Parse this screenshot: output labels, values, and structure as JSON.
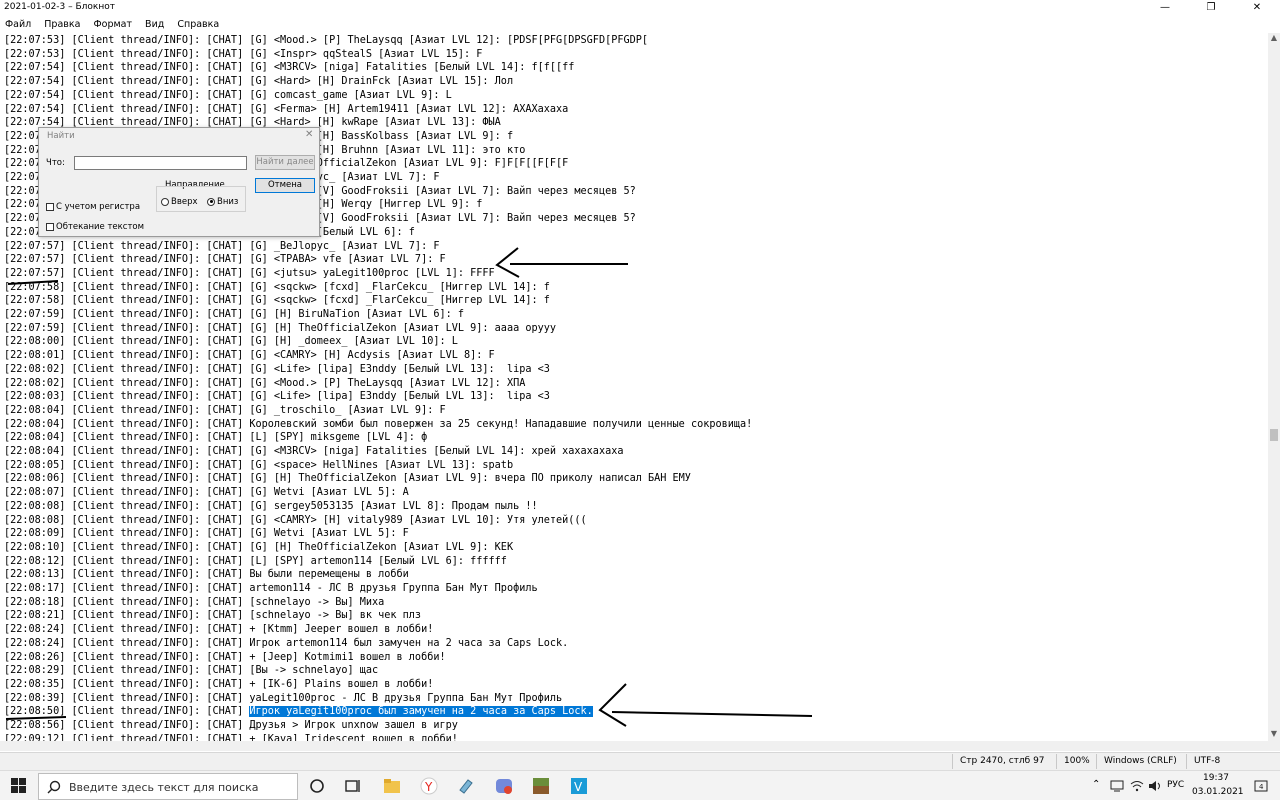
{
  "window": {
    "title": "2021-01-02-3 – Блокнот"
  },
  "menu": [
    "Файл",
    "Правка",
    "Формат",
    "Вид",
    "Справка"
  ],
  "lines": [
    "[22:07:53] [Client thread/INFO]: [CHAT] [G] <Mood.> [P] TheLaysqq [Азиат LVL 12]: [PDSF[PFG[DPSGFD[PFGDP[",
    "[22:07:53] [Client thread/INFO]: [CHAT] [G] <Inspr> qqStealS [Азиат LVL 15]: F",
    "[22:07:54] [Client thread/INFO]: [CHAT] [G] <M3RCV> [niga] Fatalities [Белый LVL 14]: f[f[[ff",
    "[22:07:54] [Client thread/INFO]: [CHAT] [G] <Hard> [H] DrainFck [Азиат LVL 15]: Лол",
    "[22:07:54] [Client thread/INFO]: [CHAT] [G] comcast_game [Азиат LVL 9]: L",
    "[22:07:54] [Client thread/INFO]: [CHAT] [G] <Ferma> [H] Artem19411 [Азиат LVL 12]: АХАХахаха",
    "[22:07:54] [Client thread/INFO]: [CHAT] [G] <Hard> [H] kwRape [Азиат LVL 13]: ФЫА",
    "[22:07:54] [Client thread/INFO]: [CHAT] [G] <Hard> [H] BassKolbass [Азиат LVL 9]: f",
    "[22:07:55] [Client thread/INFO]: [CHAT] [G] <Hard> [H] Bruhnn [Азиат LVL 11]: это кто",
    "[22:07:55] [Client thread/INFO]: [CHAT] [G] [H] TheOfficialZekon [Азиат LVL 9]: F]F[F[[F[F[F",
    "[22:07:55] [Client thread/INFO]: [CHAT] [G] _BeJlopyc_ [Азиат LVL 7]: F",
    "[22:07:56] [Client thread/INFO]: [CHAT] [G] <Hard> [V] GoodFroksii [Азиат LVL 7]: Вайп через месяцев 5?",
    "[22:07:56] [Client thread/INFO]: [CHAT] [G] <Hard> [H] Werqy [Ниггер LVL 9]: f",
    "[22:07:56] [Client thread/INFO]: [CHAT] [G] <Hard> [V] GoodFroksii [Азиат LVL 7]: Вайп через месяцев 5?",
    "[22:07:57] [Client thread/INFO]: [CHAT] [G] ramyo4 [Белый LVL 6]: f",
    "[22:07:57] [Client thread/INFO]: [CHAT] [G] _BeJlopyc_ [Азиат LVL 7]: F",
    "[22:07:57] [Client thread/INFO]: [CHAT] [G] <TPABA> vfe [Азиат LVL 7]: F",
    "[22:07:57] [Client thread/INFO]: [CHAT] [G] <jutsu> yaLegit100proc [LVL 1]: FFFF",
    "[22:07:58] [Client thread/INFO]: [CHAT] [G] <sqckw> [fcxd] _FlarCekcu_ [Ниггер LVL 14]: f",
    "[22:07:58] [Client thread/INFO]: [CHAT] [G] <sqckw> [fcxd] _FlarCekcu_ [Ниггер LVL 14]: f",
    "[22:07:59] [Client thread/INFO]: [CHAT] [G] [H] BiruNaTion [Азиат LVL 6]: f",
    "[22:07:59] [Client thread/INFO]: [CHAT] [G] [H] TheOfficialZekon [Азиат LVL 9]: аааа оруyy",
    "[22:08:00] [Client thread/INFO]: [CHAT] [G] [H] _domeex_ [Азиат LVL 10]: L",
    "[22:08:01] [Client thread/INFO]: [CHAT] [G] <CAMRY> [H] Acdysis [Азиат LVL 8]: F",
    "[22:08:02] [Client thread/INFO]: [CHAT] [G] <Life> [lipa] E3nddy [Белый LVL 13]:  lipa <3",
    "[22:08:02] [Client thread/INFO]: [CHAT] [G] <Mood.> [P] TheLaysqq [Азиат LVL 12]: ХПА",
    "[22:08:03] [Client thread/INFO]: [CHAT] [G] <Life> [lipa] E3nddy [Белый LVL 13]:  lipa <3",
    "[22:08:04] [Client thread/INFO]: [CHAT] [G] _troschilo_ [Азиат LVL 9]: F",
    "[22:08:04] [Client thread/INFO]: [CHAT] Королевский зомби был повержен за 25 секунд! Нападавшие получили ценные сокровища!",
    "[22:08:04] [Client thread/INFO]: [CHAT] [L] [SPY] miksgeme [LVL 4]: ф",
    "[22:08:04] [Client thread/INFO]: [CHAT] [G] <M3RCV> [niga] Fatalities [Белый LVL 14]: хрей хахахахаха",
    "[22:08:05] [Client thread/INFO]: [CHAT] [G] <space> HellNines [Азиат LVL 13]: spatb",
    "[22:08:06] [Client thread/INFO]: [CHAT] [G] [H] TheOfficialZekon [Азиат LVL 9]: вчера ПО приколу написал БАН ЕМУ",
    "[22:08:07] [Client thread/INFO]: [CHAT] [G] Wetvi [Азиат LVL 5]: A",
    "[22:08:08] [Client thread/INFO]: [CHAT] [G] sergey5053135 [Азиат LVL 8]: Продам пыль !!",
    "[22:08:08] [Client thread/INFO]: [CHAT] [G] <CAMRY> [H] vitaly989 [Азиат LVL 10]: Утя улетей(((",
    "[22:08:09] [Client thread/INFO]: [CHAT] [G] Wetvi [Азиат LVL 5]: F",
    "[22:08:10] [Client thread/INFO]: [CHAT] [G] [H] TheOfficialZekon [Азиат LVL 9]: KEK",
    "[22:08:12] [Client thread/INFO]: [CHAT] [L] [SPY] artemon114 [Белый LVL 6]: ffffff",
    "[22:08:13] [Client thread/INFO]: [CHAT] Вы были перемещены в лобби",
    "[22:08:17] [Client thread/INFO]: [CHAT] artemon114 - ЛС В друзья Группа Бан Мут Профиль",
    "[22:08:18] [Client thread/INFO]: [CHAT] [schnelayo -> Вы] Миха",
    "[22:08:21] [Client thread/INFO]: [CHAT] [schnelayo -> Вы] вк чек плз",
    "[22:08:24] [Client thread/INFO]: [CHAT] + [Ktmm] Jeeper вошел в лобби!",
    "[22:08:24] [Client thread/INFO]: [CHAT] Игрок artemon114 был замучен на 2 часа за Caps Lock.",
    "[22:08:26] [Client thread/INFO]: [CHAT] + [Jeep] Kotmimi1 вошел в лобби!",
    "[22:08:29] [Client thread/INFO]: [CHAT] [Вы -> schnelayo] щас",
    "[22:08:35] [Client thread/INFO]: [CHAT] + [IK-6] Plains вошел в лобби!",
    "[22:08:39] [Client thread/INFO]: [CHAT] yaLegit100proc - ЛС В друзья Группа Бан Мут Профиль",
    "[22:08:50] [Client thread/INFO]: [CHAT] ",
    "[22:08:56] [Client thread/INFO]: [CHAT] Друзья > Игрок unxnow зашел в игру",
    "[22:09:12] [Client thread/INFO]: [CHAT] + [Kava] Iridescent вошел в лобби!"
  ],
  "selected_text": "Игрок yaLegit100proc был замучен на 2 часа за Caps Lock.",
  "find_dialog": {
    "title": "Найти",
    "what_label": "Что:",
    "what_value": "",
    "find_next": "Найти далее",
    "cancel": "Отмена",
    "direction_label": "Направление",
    "up": "Вверх",
    "down": "Вниз",
    "match_case": "С учетом регистра",
    "wrap": "Обтекание текстом"
  },
  "status": {
    "position": "Стр 2470, стлб 97",
    "zoom": "100%",
    "eol": "Windows (CRLF)",
    "encoding": "UTF-8"
  },
  "taskbar": {
    "search_placeholder": "Введите здесь текст для поиска",
    "lang": "РУС",
    "time": "19:37",
    "date": "03.01.2021"
  }
}
